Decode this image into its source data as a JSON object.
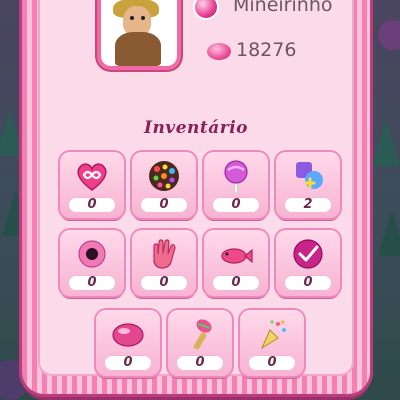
{
  "profile": {
    "user_name": "Mineirinho",
    "gold": "18276"
  },
  "inventory": {
    "title": "Inventário",
    "items": [
      {
        "icon": "heart-infinity-icon",
        "count": "0"
      },
      {
        "icon": "color-bomb-icon",
        "count": "0"
      },
      {
        "icon": "lollipop-hammer-icon",
        "count": "0"
      },
      {
        "icon": "switch-booster-icon",
        "count": "2"
      },
      {
        "icon": "jelly-fish-icon",
        "count": "0"
      },
      {
        "icon": "free-hand-icon",
        "count": "0"
      },
      {
        "icon": "sweet-fish-icon",
        "count": "0"
      },
      {
        "icon": "checkmark-candy-icon",
        "count": "0"
      },
      {
        "icon": "pink-candy-icon",
        "count": "0"
      },
      {
        "icon": "striped-brush-icon",
        "count": "0"
      },
      {
        "icon": "party-popper-icon",
        "count": "0"
      }
    ]
  },
  "colors": {
    "panel_border": "#f47fb3",
    "panel_fill": "#fbdbe9",
    "title": "#8b1f58",
    "slot_fill": "#f7b3d3"
  }
}
